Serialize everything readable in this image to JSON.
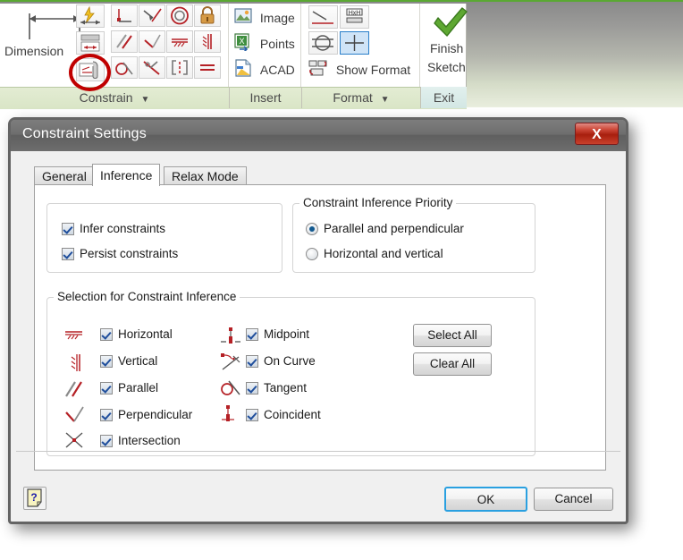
{
  "ribbon": {
    "panels": [
      {
        "name": "Constrain",
        "label": "Constrain",
        "has_dropdown": true
      },
      {
        "name": "Insert",
        "label": "Insert",
        "has_dropdown": false
      },
      {
        "name": "Format",
        "label": "Format",
        "has_dropdown": true
      },
      {
        "name": "Exit",
        "label": "Exit",
        "has_dropdown": false
      }
    ],
    "dropdown_glyph": "▼",
    "constrain": {
      "big_button_label": "Dimension",
      "big_button_icon": "dimension-icon",
      "column_icons": [
        "rapid-dimension-icon",
        "dimension-list-icon",
        "constraint-settings-icon"
      ],
      "grid_icons": [
        "fix-point-icon",
        "perpendicular-line-icon",
        "concentric-icon",
        "lock-icon",
        "parallel-icon",
        "perpendicular-icon",
        "horizontal-icon",
        "vertical-icon",
        "tangent-icon",
        "make-symmetric-icon",
        "equal-length-icon",
        "equal-icon"
      ],
      "highlighted_icon": "constraint-settings-icon"
    },
    "insert": {
      "items": [
        {
          "label": "Image",
          "icon": "image-icon"
        },
        {
          "label": "Points",
          "icon": "points-icon"
        },
        {
          "label": "ACAD",
          "icon": "acad-icon"
        }
      ]
    },
    "format": {
      "icons": [
        "make-line-continuous-icon",
        "hxh-size-icon",
        "convert-to-reference-icon",
        "display-grid-icon"
      ],
      "active_icon": "display-grid-icon",
      "show_format_label": "Show Format",
      "show_format_icon": "show-format-icon"
    },
    "exit": {
      "label_line1": "Finish",
      "label_line2": "Sketch",
      "icon": "green-checkmark-icon"
    }
  },
  "dialog": {
    "title": "Constraint Settings",
    "close_label": "X",
    "tabs": [
      {
        "label": "General",
        "active": false
      },
      {
        "label": "Inference",
        "active": true
      },
      {
        "label": "Relax Mode",
        "active": false
      }
    ],
    "inference": {
      "left_group": {
        "title": "",
        "checkboxes": [
          {
            "label": "Infer constraints",
            "checked": true
          },
          {
            "label": "Persist constraints",
            "checked": true
          }
        ]
      },
      "priority_group": {
        "title": "Constraint Inference Priority",
        "radios": [
          {
            "label": "Parallel and perpendicular",
            "selected": true
          },
          {
            "label": "Horizontal and vertical",
            "selected": false
          }
        ]
      },
      "selection_group": {
        "title": "Selection for Constraint Inference",
        "column1": [
          {
            "label": "Horizontal",
            "checked": true,
            "icon": "horizontal-constraint-icon"
          },
          {
            "label": "Vertical",
            "checked": true,
            "icon": "vertical-constraint-icon"
          },
          {
            "label": "Parallel",
            "checked": true,
            "icon": "parallel-constraint-icon"
          },
          {
            "label": "Perpendicular",
            "checked": true,
            "icon": "perpendicular-constraint-icon"
          },
          {
            "label": "Intersection",
            "checked": true,
            "icon": "intersection-constraint-icon"
          }
        ],
        "column2": [
          {
            "label": "Midpoint",
            "checked": true,
            "icon": "midpoint-constraint-icon"
          },
          {
            "label": "On Curve",
            "checked": true,
            "icon": "on-curve-constraint-icon"
          },
          {
            "label": "Tangent",
            "checked": true,
            "icon": "tangent-constraint-icon"
          },
          {
            "label": "Coincident",
            "checked": true,
            "icon": "coincident-constraint-icon"
          }
        ],
        "buttons": [
          {
            "label": "Select All"
          },
          {
            "label": "Clear All"
          }
        ]
      }
    },
    "footer": {
      "help_glyph": "?",
      "ok_label": "OK",
      "cancel_label": "Cancel"
    }
  },
  "colors": {
    "accent_green": "#5aa832",
    "close_red": "#a81f0e",
    "constraint_red": "#b52025",
    "default_button_blue": "#2aa0e0",
    "annotation_red": "#c00000",
    "panel_label_bg": "#dde8c9"
  }
}
